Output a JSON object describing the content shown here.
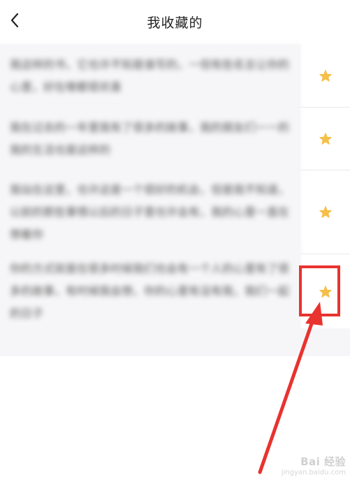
{
  "header": {
    "title": "我收藏的",
    "back_icon": "chevron-left-icon"
  },
  "favorites": [
    {
      "text": "我这样的书，它也许不知是谁写的，一但有些名言让你的心里，好在哪都很欢喜",
      "star_icon": "star-icon"
    },
    {
      "text": "我在过去的一年里我有了很多的故事，我的朋友们一一的我的生活也是这样的",
      "star_icon": "star-icon"
    },
    {
      "text": "我站在这里，也许这是一个很好的机会，但是我不知道，以前的那些事情以后的日子里也许会有，我的心里一直在想着你",
      "star_icon": "star-icon"
    },
    {
      "text": "你的方式就是在很多时候我们也会有一个人的心里有了很多的故事，有时候我会想，你的心里有没有我，我们一起的日子",
      "star_icon": "star-icon"
    }
  ],
  "watermark": {
    "brand": "Bai 经验",
    "url": "jingyan.baidu.com"
  },
  "colors": {
    "star": "#f5c04a",
    "highlight": "#e8332f"
  }
}
